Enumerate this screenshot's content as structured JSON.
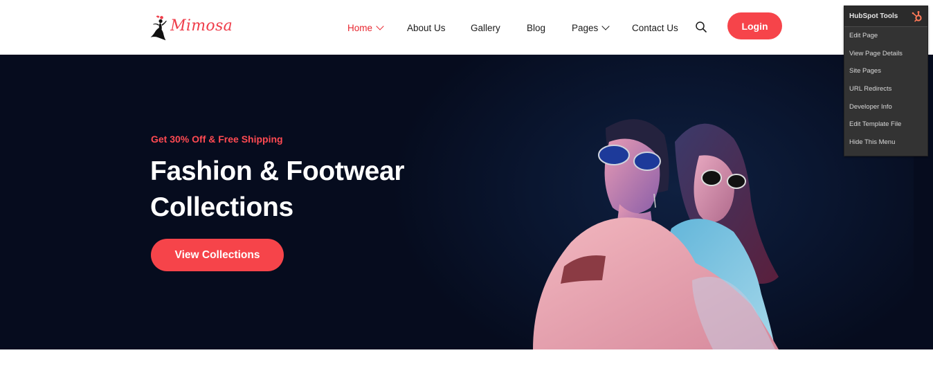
{
  "brand": {
    "name": "Mimosa",
    "accent": "#f6444a",
    "active_nav": "#e8262f",
    "hero_bg": "#060c1e"
  },
  "nav": {
    "items": [
      {
        "label": "Home",
        "dropdown": true,
        "active": true
      },
      {
        "label": "About Us"
      },
      {
        "label": "Gallery"
      },
      {
        "label": "Blog"
      },
      {
        "label": "Pages",
        "dropdown": true
      },
      {
        "label": "Contact Us"
      }
    ],
    "search_icon": "search-icon",
    "login_label": "Login"
  },
  "hero": {
    "promo": "Get 30% Off & Free Shipping",
    "title_line1": "Fashion & Footwear",
    "title_line2": "Collections",
    "cta_label": "View Collections"
  },
  "hubspot": {
    "title": "HubSpot Tools",
    "items": [
      "Edit Page",
      "View Page Details",
      "Site Pages",
      "URL Redirects",
      "Developer Info",
      "Edit Template File",
      "Hide This Menu"
    ]
  }
}
